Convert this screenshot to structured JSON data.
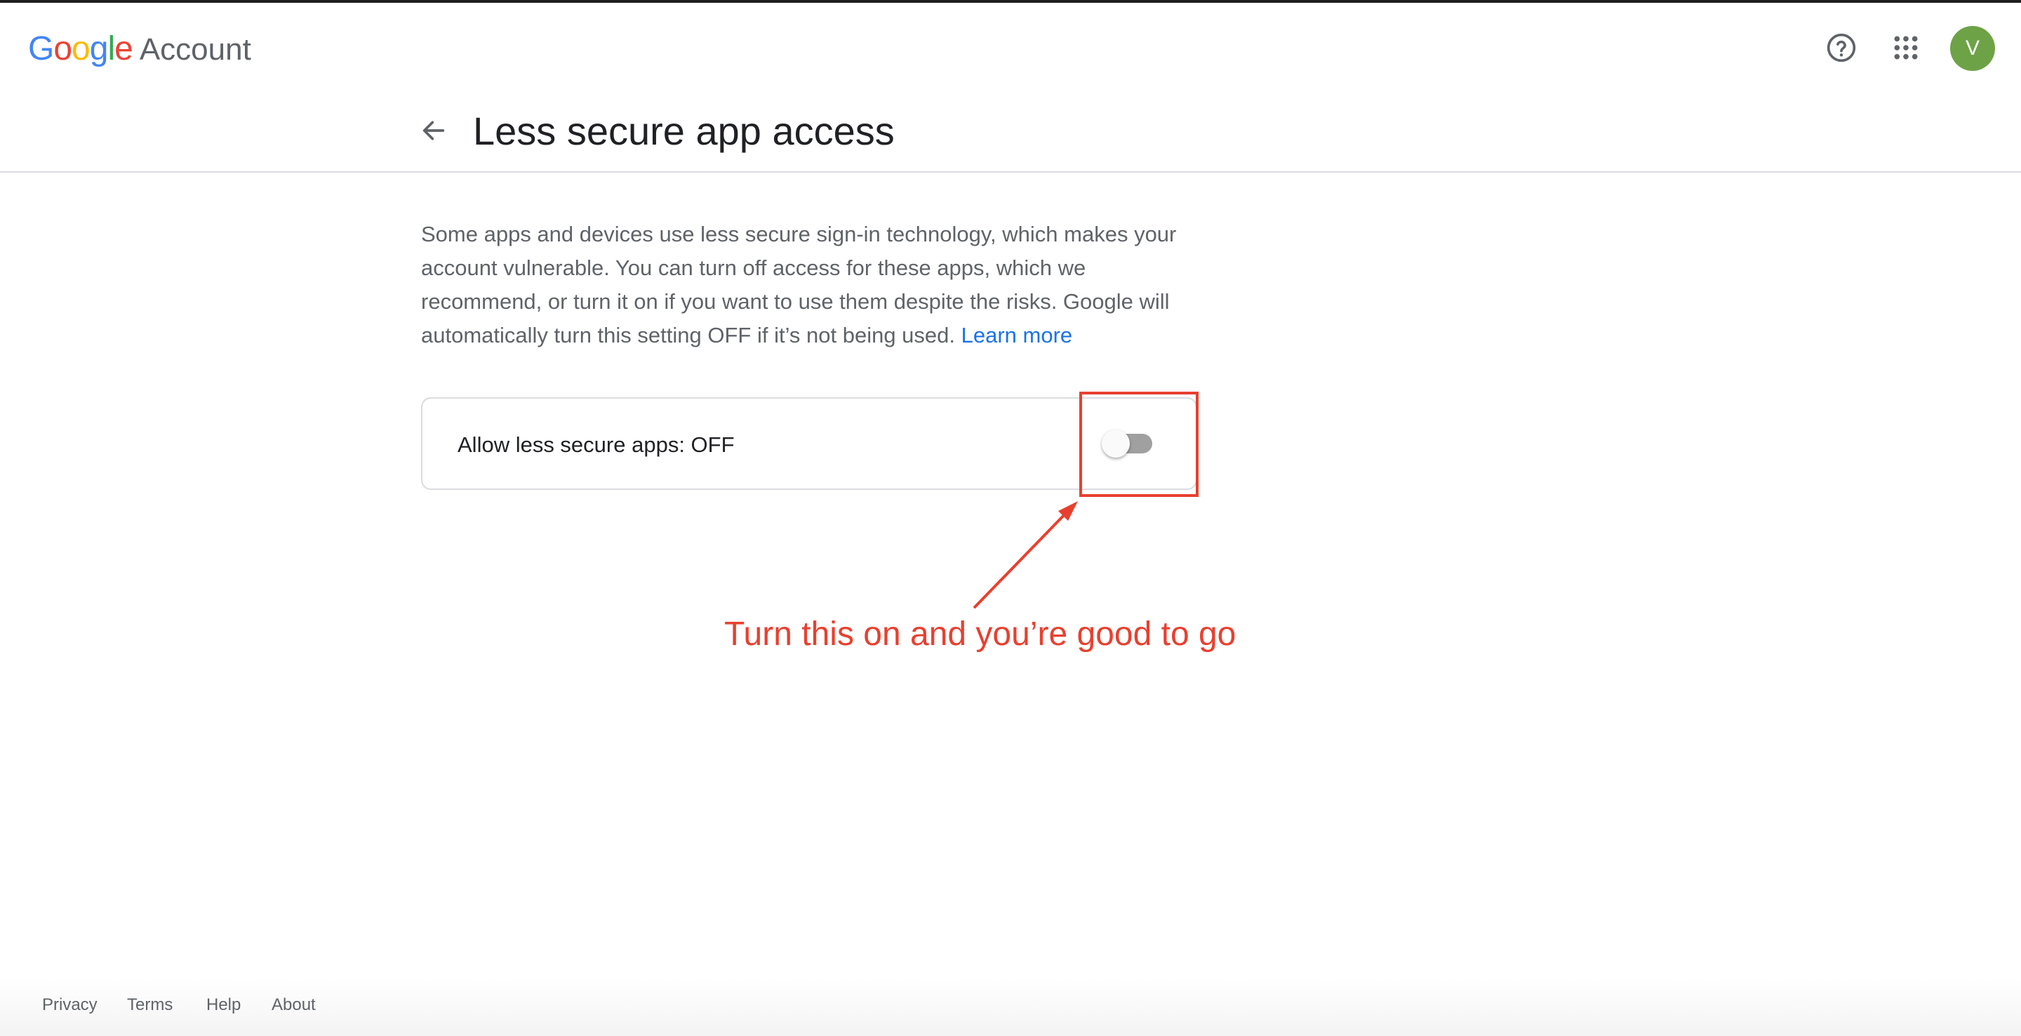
{
  "header": {
    "logo_google": "Google",
    "logo_account": "Account",
    "help_icon": "help-circle-icon",
    "apps_icon": "apps-grid-icon",
    "avatar_letter": "V",
    "avatar_color": "#6ea246"
  },
  "titlebar": {
    "back_icon": "arrow-left-icon",
    "title": "Less secure app access"
  },
  "main": {
    "description": "Some apps and devices use less secure sign-in technology, which makes your account vulnerable. You can turn off access for these apps, which we recommend, or turn it on if you want to use them despite the risks. Google will automatically turn this setting OFF if it’s not being used.",
    "learn_more": "Learn more",
    "setting_label": "Allow less secure apps: OFF",
    "toggle_state": "off"
  },
  "annotation": {
    "text": "Turn this on and you’re good to go",
    "color": "#e8402f"
  },
  "footer": {
    "links": [
      "Privacy",
      "Terms",
      "Help",
      "About"
    ]
  },
  "colors": {
    "link": "#1a73e8",
    "text_primary": "#202124",
    "text_secondary": "#5f6368",
    "divider": "#dadce0"
  }
}
